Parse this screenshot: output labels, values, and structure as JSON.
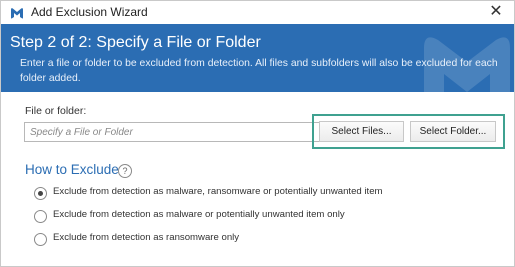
{
  "window": {
    "title": "Add Exclusion Wizard",
    "close_symbol": "✕"
  },
  "header": {
    "step_title": "Step 2 of 2: Specify a File or Folder",
    "description": "Enter a file or folder to be excluded from detection. All files and subfolders will also be excluded for each folder added."
  },
  "file_field": {
    "label": "File or folder:",
    "placeholder": "Specify a File or Folder",
    "value": ""
  },
  "buttons": {
    "select_files": "Select Files...",
    "select_folder": "Select Folder..."
  },
  "how_to_exclude": {
    "title": "How to Exclude",
    "help_symbol": "?",
    "options": [
      {
        "label": "Exclude from detection as malware, ransomware or potentially unwanted item",
        "checked": true
      },
      {
        "label": "Exclude from detection as malware or potentially unwanted item only",
        "checked": false
      },
      {
        "label": "Exclude from detection as ransomware only",
        "checked": false
      }
    ]
  },
  "colors": {
    "header_blue": "#2b6db3",
    "highlight_teal": "#3fa190",
    "title_blue": "#2b6db3"
  },
  "icons": {
    "app": "malwarebytes-logo-icon",
    "close": "close-icon",
    "help": "help-icon"
  }
}
